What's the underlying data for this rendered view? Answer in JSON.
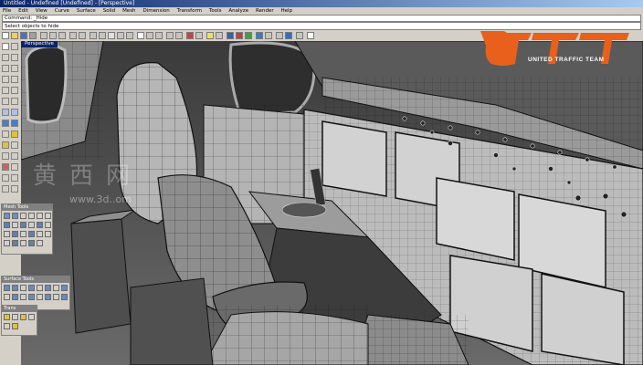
{
  "window": {
    "title": "Untitled - Undefined [Undefined] - [Perspective]"
  },
  "menu": [
    "File",
    "Edit",
    "View",
    "Curve",
    "Surface",
    "Solid",
    "Mesh",
    "Dimension",
    "Transform",
    "Tools",
    "Analyze",
    "Render",
    "Help"
  ],
  "command": {
    "history": "Command: _Hide",
    "prompt": "Select objects to hide"
  },
  "viewport": {
    "label": "Perspective"
  },
  "panels": {
    "mesh_tools_title": "Mesh Tools",
    "surface_tools_title": "Surface Tools",
    "transform_title": "Trans"
  },
  "logo": {
    "text": "UTT",
    "tagline": "UNITED TRAFFIC TEAM",
    "accent": "#e8601c"
  },
  "watermark": {
    "text": "黄西网",
    "url": "www.3d..om"
  },
  "colors": {
    "titlebar": "#0a246a",
    "ui": "#d4d0c8",
    "wire": "#1a1a1a",
    "surface": "#c8c8c8"
  },
  "icons": [
    "new-file-icon",
    "open-icon",
    "save-icon",
    "print-icon",
    "cut-icon",
    "copy-icon",
    "paste-icon",
    "undo-icon",
    "redo-icon",
    "pan-icon",
    "rotate-icon",
    "zoom-icon",
    "zoom-window-icon",
    "zoom-extents-icon",
    "grid-icon",
    "layer-icon",
    "properties-icon",
    "render-icon",
    "light-icon",
    "help-icon"
  ]
}
